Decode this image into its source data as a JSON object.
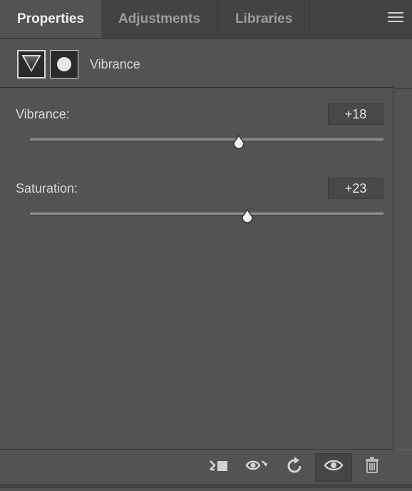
{
  "tabs": {
    "properties": "Properties",
    "adjustments": "Adjustments",
    "libraries": "Libraries"
  },
  "adjustment": {
    "name": "Vibrance"
  },
  "sliders": {
    "vibrance": {
      "label": "Vibrance:",
      "value": "+18",
      "position_pct": 59
    },
    "saturation": {
      "label": "Saturation:",
      "value": "+23",
      "position_pct": 61.5
    }
  },
  "icons": {
    "menu": "panel-menu",
    "clip": "clip-to-layer",
    "viewprev": "view-previous-state",
    "reset": "reset-to-default",
    "visibility": "toggle-visibility",
    "delete": "delete-adjustment"
  }
}
